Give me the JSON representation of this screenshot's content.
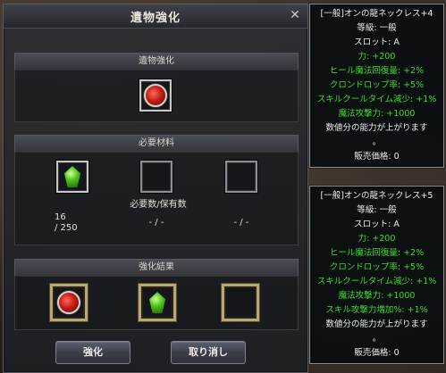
{
  "dialog": {
    "title": "遺物強化",
    "close_glyph": "✕",
    "sections": {
      "relic_title": "遺物強化",
      "materials_title": "必要材料",
      "required_owned_label": "必要数/保有数",
      "result_title": "強化結果"
    },
    "materials": [
      {
        "count": "16",
        "total": "/ 250",
        "icon": "green-gem-icon"
      },
      {
        "count": "- / -",
        "icon": "empty"
      },
      {
        "count": "- / -",
        "icon": "empty"
      }
    ],
    "buttons": {
      "enhance": "強化",
      "cancel": "取り消し"
    }
  },
  "tooltips": [
    {
      "lines": [
        {
          "text": "[一般]オンの龍ネックレス+4",
          "color": "w"
        },
        {
          "text": "等級: 一般",
          "color": "w"
        },
        {
          "text": "スロット: A",
          "color": "w"
        },
        {
          "text": "力: +200",
          "color": "g"
        },
        {
          "text": "ヒール魔法回復量: +2%",
          "color": "g"
        },
        {
          "text": "クロンドロップ率: +5%",
          "color": "g"
        },
        {
          "text": "スキルクールタイム減少: +1%",
          "color": "g"
        },
        {
          "text": "魔法攻撃力: +1000",
          "color": "g"
        },
        {
          "text": "数値分の能力が上がります",
          "color": "w"
        },
        {
          "text": "。",
          "color": "w"
        },
        {
          "text": "販売価格: 0",
          "color": "w"
        }
      ]
    },
    {
      "lines": [
        {
          "text": "[一般]オンの龍ネックレス+5",
          "color": "w"
        },
        {
          "text": "等級: 一般",
          "color": "w"
        },
        {
          "text": "スロット: A",
          "color": "w"
        },
        {
          "text": "力: +200",
          "color": "g"
        },
        {
          "text": "ヒール魔法回復量: +2%",
          "color": "g"
        },
        {
          "text": "クロンドロップ率: +5%",
          "color": "g"
        },
        {
          "text": "スキルクールタイム減少: +1%",
          "color": "g"
        },
        {
          "text": "魔法攻撃力: +1000",
          "color": "g"
        },
        {
          "text": "スキル攻撃力増加%: +1%",
          "color": "g"
        },
        {
          "text": "数値分の能力が上がります",
          "color": "w"
        },
        {
          "text": "。",
          "color": "w"
        },
        {
          "text": "販売価格: 0",
          "color": "w"
        }
      ]
    }
  ]
}
